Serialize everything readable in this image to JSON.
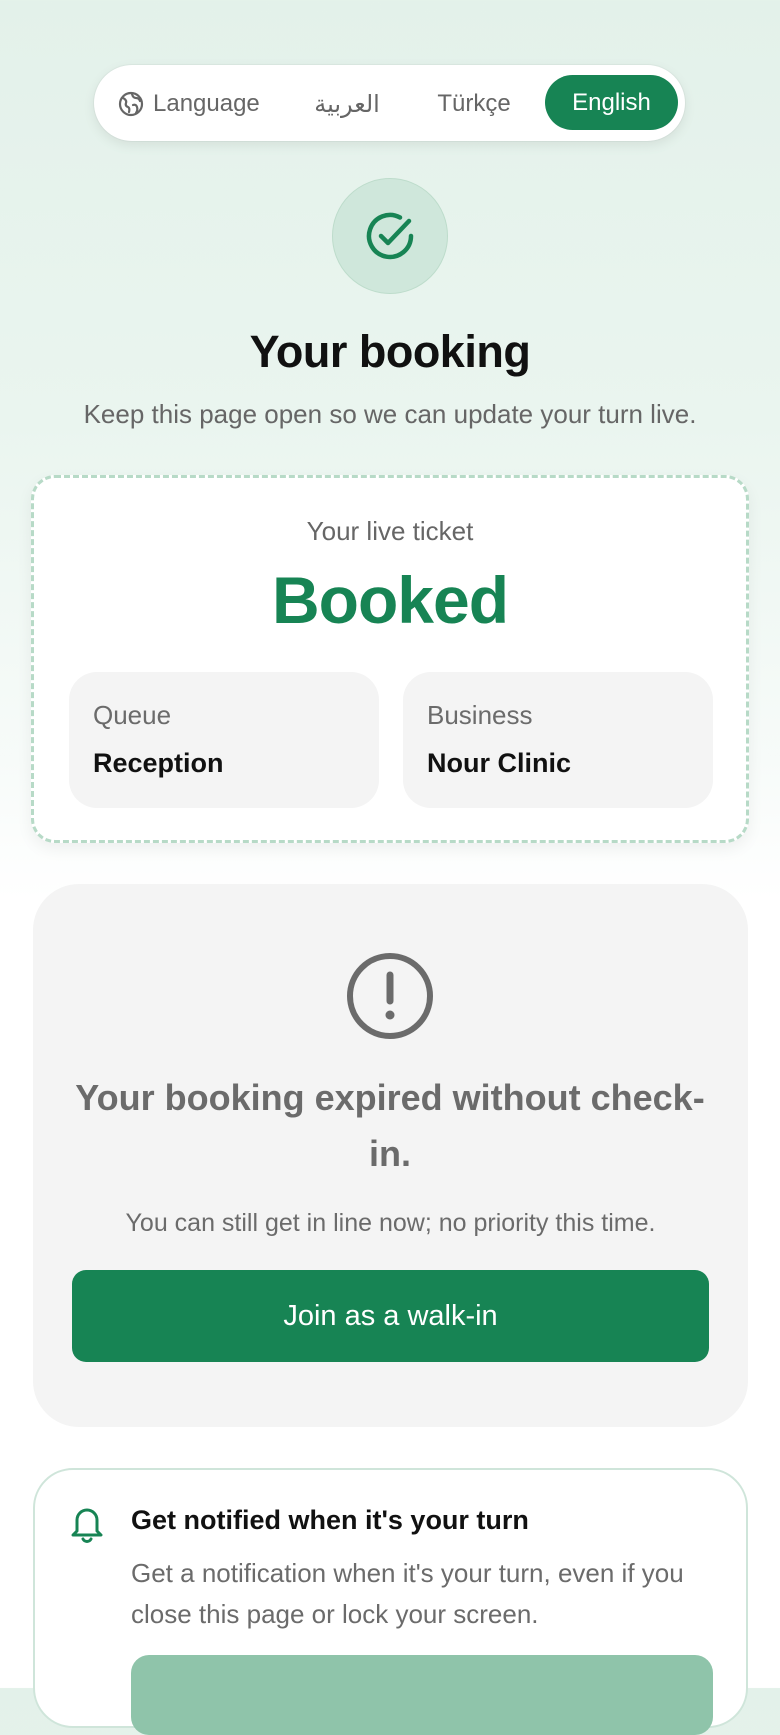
{
  "language": {
    "label": "Language",
    "icon": "globe-icon",
    "options": [
      "العربية",
      "Türkçe",
      "English"
    ],
    "selected": "English"
  },
  "header": {
    "icon": "check-circle-icon",
    "title": "Your booking",
    "subtitle": "Keep this page open so we can update your turn live."
  },
  "ticket": {
    "label": "Your live ticket",
    "status": "Booked",
    "queue_label": "Queue",
    "queue_value": "Reception",
    "business_label": "Business",
    "business_value": "Nour Clinic"
  },
  "expired": {
    "icon": "alert-circle-icon",
    "title": "Your booking expired without check-in.",
    "description": "You can still get in line now; no priority this time.",
    "button_label": "Join as a walk-in"
  },
  "notify": {
    "icon": "bell-icon",
    "title": "Get notified when it's your turn",
    "description": "Get a notification when it's your turn, even if you close this page or lock your screen."
  },
  "colors": {
    "accent": "#178454",
    "accent_light": "#cfe7db",
    "muted_text": "#666666",
    "card_gray": "#f4f4f4"
  }
}
